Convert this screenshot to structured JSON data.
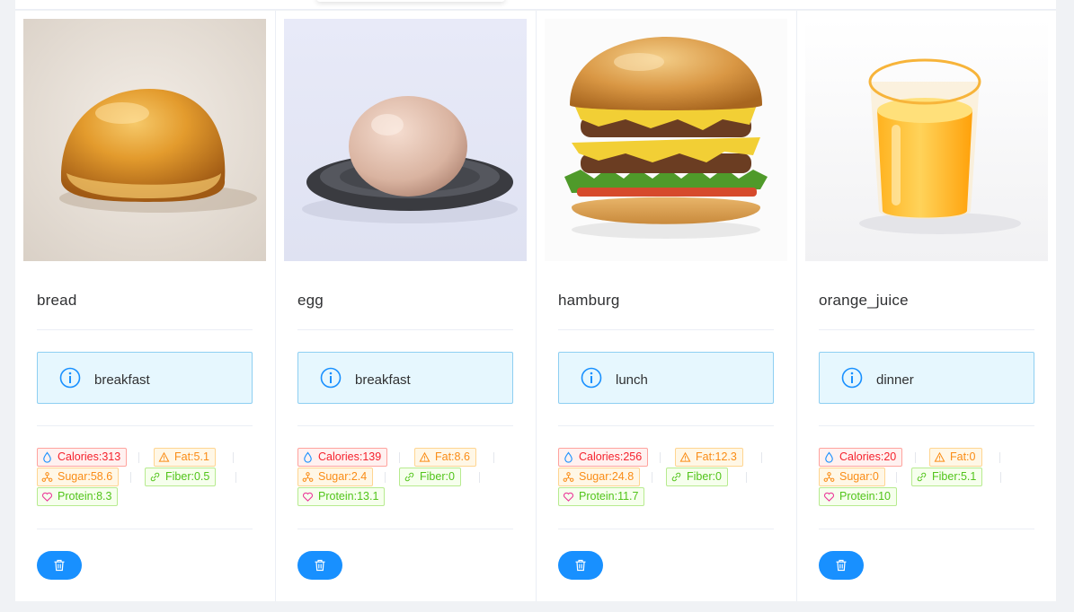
{
  "accent_color": "#1890ff",
  "foods": [
    {
      "name": "bread",
      "image_icon": "bread-image",
      "meal": "breakfast",
      "calories": "Calories:313",
      "fat": "Fat:5.1",
      "sugar": "Sugar:58.6",
      "fiber": "Fiber:0.5",
      "protein": "Protein:8.3"
    },
    {
      "name": "egg",
      "image_icon": "egg-image",
      "meal": "breakfast",
      "calories": "Calories:139",
      "fat": "Fat:8.6",
      "sugar": "Sugar:2.4",
      "fiber": "Fiber:0",
      "protein": "Protein:13.1"
    },
    {
      "name": "hamburg",
      "image_icon": "hamburger-image",
      "meal": "lunch",
      "calories": "Calories:256",
      "fat": "Fat:12.3",
      "sugar": "Sugar:24.8",
      "fiber": "Fiber:0",
      "protein": "Protein:11.7"
    },
    {
      "name": "orange_juice",
      "image_icon": "orange-juice-image",
      "meal": "dinner",
      "calories": "Calories:20",
      "fat": "Fat:0",
      "sugar": "Sugar:0",
      "fiber": "Fiber:5.1",
      "protein": "Protein:10"
    }
  ],
  "tag_colors": {
    "calories": "#f5222d",
    "fat": "#fa8c16",
    "sugar": "#fa8c16",
    "fiber": "#52c41a",
    "protein": "#52c41a"
  },
  "icons": {
    "calories": "droplet-icon",
    "fat": "warning-icon",
    "sugar": "cluster-icon",
    "fiber": "link-icon",
    "protein": "heart-icon",
    "meal": "info-circle-icon",
    "delete": "trash-icon"
  }
}
